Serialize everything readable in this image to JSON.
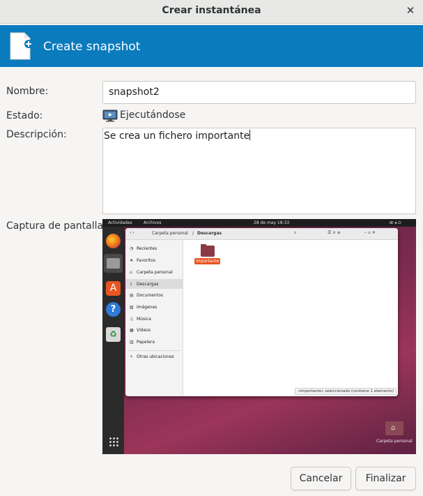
{
  "window": {
    "title": "Crear instantánea",
    "close_icon": "close-icon"
  },
  "banner": {
    "title": "Create snapshot",
    "icon": "new-document-icon",
    "color": "#0a7bbd"
  },
  "form": {
    "name_label": "Nombre:",
    "name_value": "snapshot2",
    "state_label": "Estado:",
    "state_value": "Ejecutándose",
    "state_icon": "monitor-running-icon",
    "description_label": "Descripción:",
    "description_value": "Se crea un fichero importante",
    "screenshot_label": "Captura de pantalla:"
  },
  "screenshot": {
    "topbar": {
      "activities": "Actividades",
      "app": "Archivos",
      "datetime": "28 de may  18:33"
    },
    "file_manager": {
      "path_home": "Carpeta personal",
      "path_current": "Descargas",
      "sidebar": [
        {
          "icon": "◔",
          "label": "Recientes"
        },
        {
          "icon": "★",
          "label": "Favoritos"
        },
        {
          "icon": "⌂",
          "label": "Carpeta personal"
        },
        {
          "icon": "⇩",
          "label": "Descargas"
        },
        {
          "icon": "▤",
          "label": "Documentos"
        },
        {
          "icon": "▨",
          "label": "Imágenes"
        },
        {
          "icon": "♫",
          "label": "Música"
        },
        {
          "icon": "▦",
          "label": "Vídeos"
        },
        {
          "icon": "▥",
          "label": "Papelera"
        },
        {
          "icon": "+",
          "label": "Otras ubicaciones"
        }
      ],
      "folder_name": "importante",
      "status": "«importante» seleccionado  (contiene 1 elemento)"
    },
    "desktop_icon_label": "Carpeta personal"
  },
  "buttons": {
    "cancel": "Cancelar",
    "finish": "Finalizar"
  }
}
